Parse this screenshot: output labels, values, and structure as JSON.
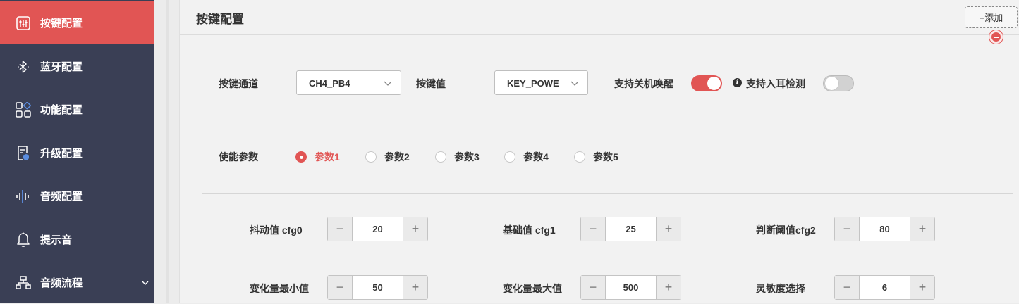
{
  "sidebar": {
    "items": [
      {
        "label": "按键配置",
        "icon": "sliders-icon",
        "active": true
      },
      {
        "label": "蓝牙配置",
        "icon": "bluetooth-icon"
      },
      {
        "label": "功能配置",
        "icon": "grid-icon"
      },
      {
        "label": "升级配置",
        "icon": "document-shield-icon"
      },
      {
        "label": "音频配置",
        "icon": "audio-wave-icon"
      },
      {
        "label": "提示音",
        "icon": "bell-icon"
      },
      {
        "label": "音频流程",
        "icon": "flowchart-icon",
        "expandable": true
      }
    ]
  },
  "panel": {
    "title": "按键配置",
    "add_label": "+添加"
  },
  "key_settings": {
    "channel_label": "按键通道",
    "channel_value": "CH4_PB4",
    "key_value_label": "按键值",
    "key_value": "KEY_POWE",
    "wake_label": "支持关机唤醒",
    "wake_on": true,
    "ear_label": "支持入耳检测",
    "ear_on": false
  },
  "params": {
    "label": "使能参数",
    "options": [
      "参数1",
      "参数2",
      "参数3",
      "参数4",
      "参数5"
    ],
    "selected_index": 0
  },
  "fields": {
    "debounce": {
      "label": "抖动值 cfg0",
      "value": "20"
    },
    "base": {
      "label": "基础值 cfg1",
      "value": "25"
    },
    "threshold": {
      "label": "判断阈值cfg2",
      "value": "80"
    },
    "delta_min": {
      "label": "变化量最小值",
      "value": "50"
    },
    "delta_max": {
      "label": "变化量最大值",
      "value": "500"
    },
    "sensitivity": {
      "label": "灵敏度选择",
      "value": "6"
    },
    "minus_symbol": "−",
    "plus_symbol": "+"
  },
  "colors": {
    "accent": "#e15554",
    "sidebar_bg": "#3a3f55"
  }
}
